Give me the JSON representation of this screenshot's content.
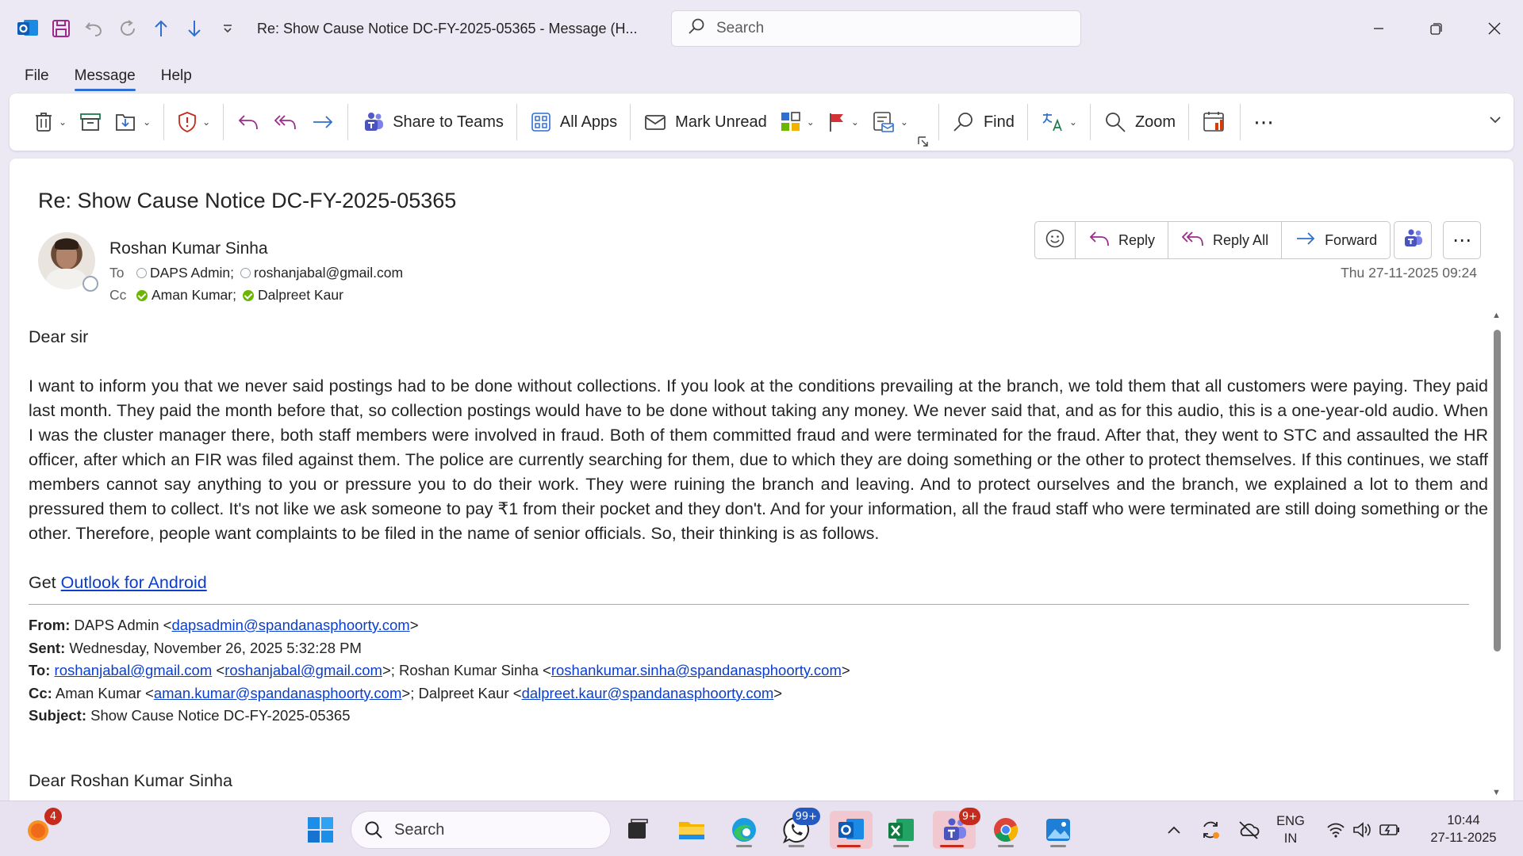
{
  "window": {
    "title": "Re: Show Cause Notice DC-FY-2025-05365  -  Message (H...",
    "search_placeholder": "Search"
  },
  "menu": [
    "File",
    "Message",
    "Help"
  ],
  "ribbon": {
    "share_teams": "Share to Teams",
    "all_apps": "All Apps",
    "mark_unread": "Mark Unread",
    "find": "Find",
    "zoom": "Zoom"
  },
  "message": {
    "subject": "Re: Show Cause Notice DC-FY-2025-05365",
    "sender": "Roshan Kumar Sinha",
    "to_label": "To",
    "to": [
      "DAPS Admin;",
      "roshanjabal@gmail.com"
    ],
    "cc_label": "Cc",
    "cc": [
      "Aman Kumar;",
      "Dalpreet Kaur"
    ],
    "date": "Thu 27-11-2025 09:24",
    "actions": {
      "reply": "Reply",
      "reply_all": "Reply All",
      "forward": "Forward"
    },
    "greeting": "Dear sir",
    "body": "I want to inform you that we never said postings had to be done without collections. If you look at the conditions prevailing at the branch, we told them that all customers were paying. They paid last month. They paid the month before that, so collection postings would have to be done without taking any money. We never said that, and as for this audio, this is a one-year-old audio. When I was the cluster manager there, both staff members were involved in fraud. Both of them committed fraud and were terminated for the fraud. After that, they went to STC and assaulted the HR officer, after which an FIR was filed against them. The police are currently searching for them, due to which they are doing something or the other to protect themselves. If this continues, we staff members cannot say anything to you or pressure you to do their work. They were ruining the branch and leaving.  And to protect ourselves and the branch, we explained a lot to them and pressured them to collect. It's not like we ask someone to pay ₹1 from their pocket and they don't. And for your information, all the fraud staff who were terminated are still doing something or the other. Therefore, people want complaints to be filed in the name of senior officials. So, their thinking is as follows.",
    "get_prefix": "Get ",
    "get_link": "Outlook for Android",
    "fwd": {
      "from_label": "From:",
      "from_name": " DAPS Admin <",
      "from_email": "dapsadmin@spandanasphoorty.com",
      "sent_label": "Sent:",
      "sent": " Wednesday, November 26, 2025 5:32:28 PM",
      "to_label": "To:",
      "to_email1": "roshanjabal@gmail.com",
      "to_email2": "roshanjabal@gmail.com",
      "to_mid": ">; Roshan Kumar Sinha <",
      "to_email3": "roshankumar.sinha@spandanasphoorty.com",
      "cc_label": "Cc:",
      "cc_name1": " Aman Kumar <",
      "cc_email1": "aman.kumar@spandanasphoorty.com",
      "cc_mid": ">; Dalpreet Kaur <",
      "cc_email2": "dalpreet.kaur@spandanasphoorty.com",
      "subject_label": "Subject:",
      "subject": " Show Cause Notice DC-FY-2025-05365"
    },
    "cut_line": "Dear Roshan Kumar Sinha"
  },
  "taskbar": {
    "search_placeholder": "Search",
    "badges": {
      "weather": "4",
      "whatsapp": "99+",
      "teams": "9+"
    },
    "lang": [
      "ENG",
      "IN"
    ],
    "time": "10:44",
    "date": "27-11-2025"
  },
  "colors": {
    "accent": "#2f6fd1",
    "link": "#0b3ecb",
    "presence_green": "#6bb700",
    "badge_red": "#c42b1c"
  }
}
